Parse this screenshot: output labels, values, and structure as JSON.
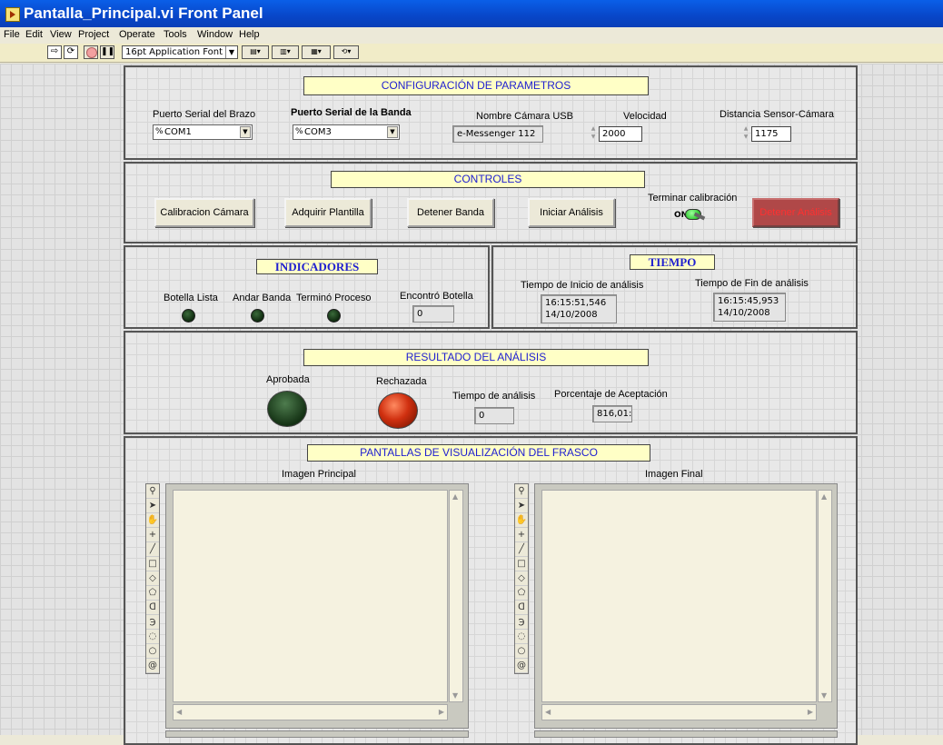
{
  "window": {
    "title": "Pantalla_Principal.vi Front Panel"
  },
  "menu": [
    "File",
    "Edit",
    "View",
    "Project",
    "Operate",
    "Tools",
    "Window",
    "Help"
  ],
  "toolbar": {
    "font": "16pt Application Font"
  },
  "config": {
    "header": "CONFIGURACIÓN DE PARAMETROS",
    "brazo_label": "Puerto Serial del Brazo",
    "brazo_value": "COM1",
    "banda_label": "Puerto Serial de la Banda",
    "banda_value": "COM3",
    "camara_label": "Nombre Cámara USB",
    "camara_value": "e-Messenger 112",
    "velocidad_label": "Velocidad",
    "velocidad_value": "2000",
    "distancia_label": "Distancia Sensor-Cámara",
    "distancia_value": "1175",
    "ring_prefix": "%"
  },
  "controles": {
    "header": "CONTROLES",
    "btn_calibracion": "Calibracion Cámara",
    "btn_plantilla": "Adquirir Plantilla",
    "btn_detener_banda": "Detener Banda",
    "btn_iniciar": "Iniciar Análisis",
    "terminar_label": "Terminar calibración",
    "terminar_state": "ON",
    "btn_detener_analisis": "Detener Análisis"
  },
  "indicadores": {
    "header": "INDICADORES",
    "botella_lista": "Botella Lista",
    "andar_banda": "Andar Banda",
    "termino_proceso": "Terminó Proceso",
    "encontro_label": "Encontró Botella",
    "encontro_value": "0"
  },
  "tiempo": {
    "header": "TIEMPO",
    "inicio_label": "Tiempo de Inicio de análisis",
    "inicio_time": "16:15:51,546",
    "inicio_date": "14/10/2008",
    "fin_label": "Tiempo de Fin de análisis",
    "fin_time": "16:15:45,953",
    "fin_date": "14/10/2008"
  },
  "resultado": {
    "header": "RESULTADO DEL ANÁLISIS",
    "aprobada": "Aprobada",
    "rechazada": "Rechazada",
    "tiempo_label": "Tiempo de análisis",
    "tiempo_value": "0",
    "porcentaje_label": "Porcentaje de Aceptación",
    "porcentaje_value": "816,01:"
  },
  "pantallas": {
    "header": "PANTALLAS DE VISUALIZACIÓN DEL FRASCO",
    "principal_label": "Imagen Principal",
    "final_label": "Imagen Final"
  },
  "colors": {
    "header_bg": "#ffffc6",
    "header_text": "#2020d0",
    "stop_button": "#b04848",
    "led_on": "#3cd23c",
    "led_red": "#d03010"
  },
  "icons": [
    "run-arrow-icon",
    "run-continuous-icon",
    "abort-icon",
    "pause-icon",
    "zoom-icon",
    "pointer-icon",
    "pan-hand-icon",
    "point-icon",
    "line-icon",
    "rectangle-icon",
    "rotated-rect-icon",
    "polygon-icon",
    "freehand-icon",
    "annulus-icon",
    "oval-icon",
    "spiral-icon"
  ]
}
